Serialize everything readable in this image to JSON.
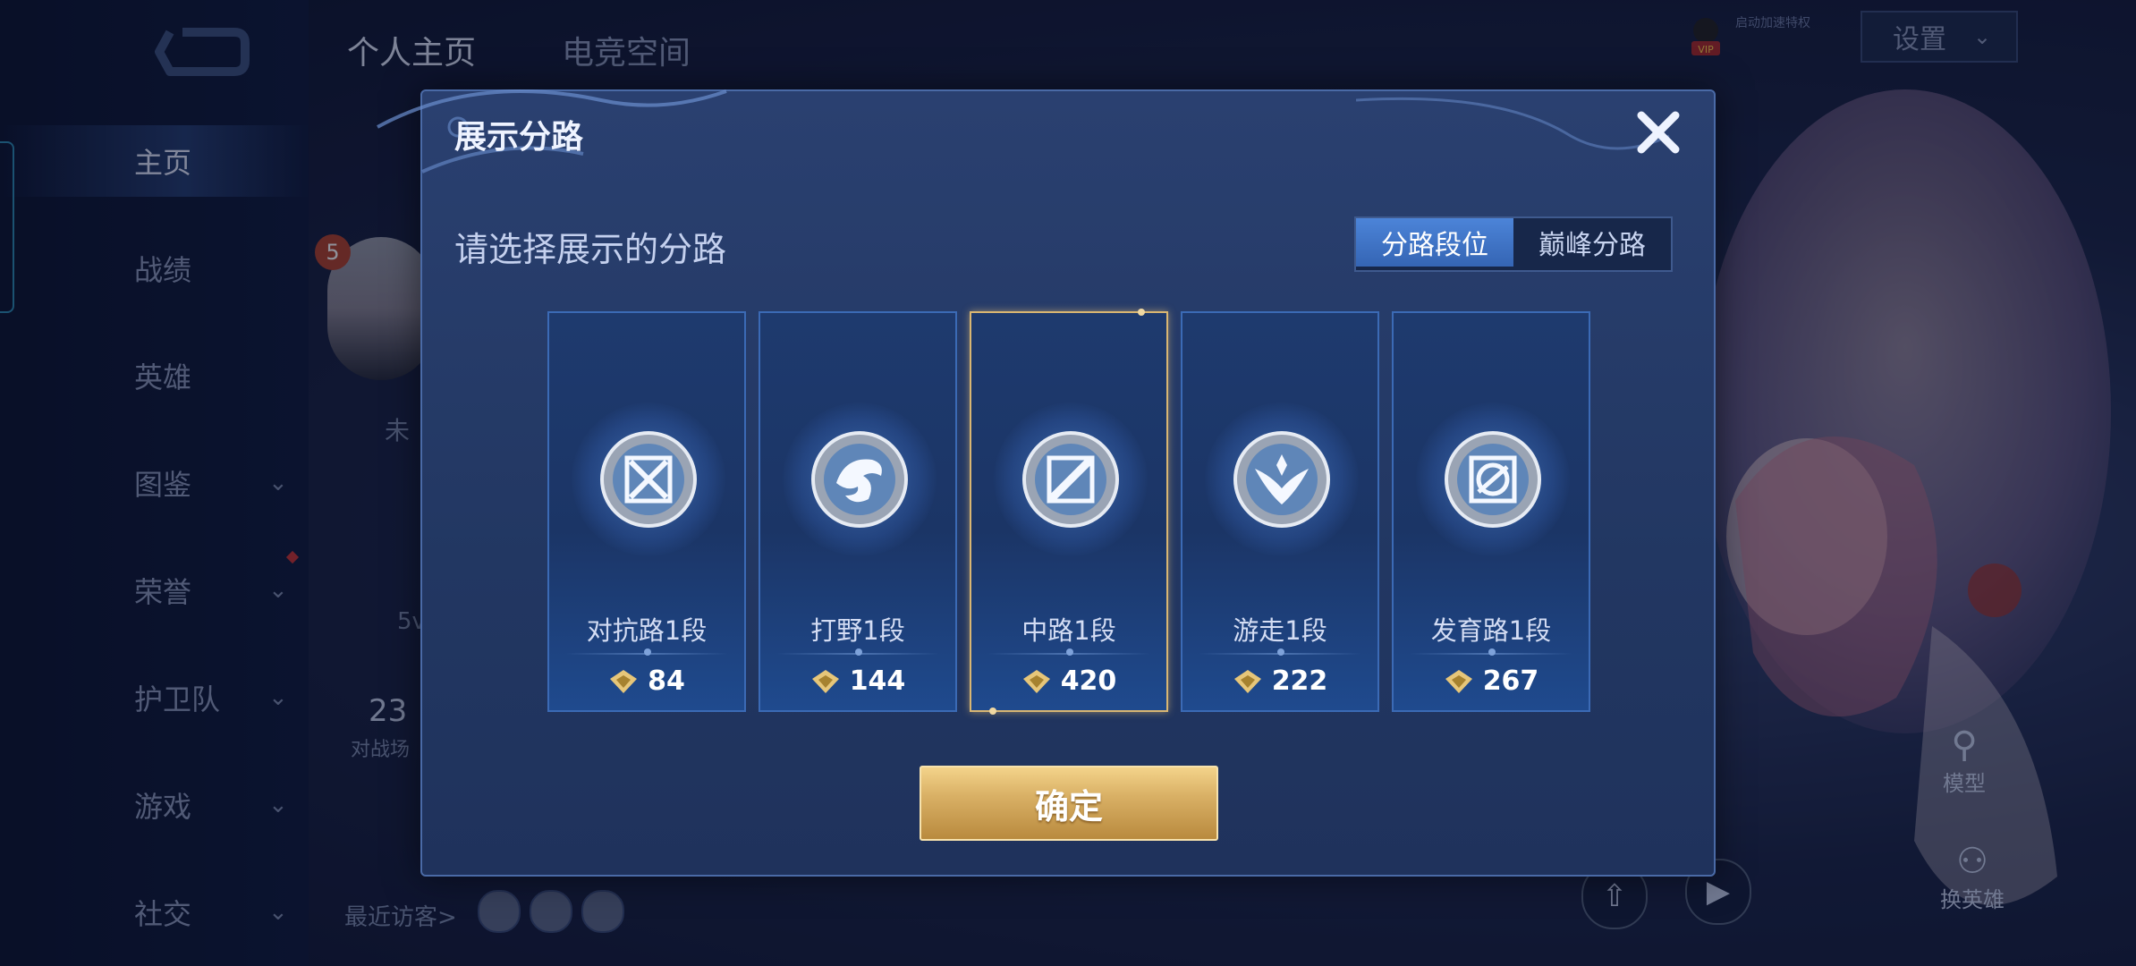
{
  "sidebar": {
    "items": [
      {
        "label": "主页",
        "has_chevron": false
      },
      {
        "label": "战绩",
        "has_chevron": false
      },
      {
        "label": "英雄",
        "has_chevron": false
      },
      {
        "label": "图鉴",
        "has_chevron": true
      },
      {
        "label": "荣誉",
        "has_chevron": true
      },
      {
        "label": "护卫队",
        "has_chevron": true
      },
      {
        "label": "游戏",
        "has_chevron": true
      },
      {
        "label": "社交",
        "has_chevron": true
      }
    ]
  },
  "top_tabs": [
    {
      "label": "个人主页",
      "active": true
    },
    {
      "label": "电竞空间",
      "active": false
    }
  ],
  "header": {
    "vip_text": "启动加速特权",
    "settings_label": "设置"
  },
  "background_profile": {
    "level": "5",
    "status_text": "未",
    "stat_value": "23",
    "stat_label": "对战场",
    "mode_text": "5v",
    "visitors_label": "最近访客>",
    "model_label": "模型",
    "hero_label": "换英雄"
  },
  "dialog": {
    "title": "展示分路",
    "subtitle": "请选择展示的分路",
    "segments": [
      {
        "label": "分路段位",
        "active": true
      },
      {
        "label": "巅峰分路",
        "active": false
      }
    ],
    "lanes": [
      {
        "name": "对抗路1段",
        "score": "84",
        "icon": "clash-lane-icon",
        "selected": false
      },
      {
        "name": "打野1段",
        "score": "144",
        "icon": "jungle-icon",
        "selected": false
      },
      {
        "name": "中路1段",
        "score": "420",
        "icon": "mid-lane-icon",
        "selected": true
      },
      {
        "name": "游走1段",
        "score": "222",
        "icon": "roam-icon",
        "selected": false
      },
      {
        "name": "发育路1段",
        "score": "267",
        "icon": "farm-lane-icon",
        "selected": false
      }
    ],
    "confirm_label": "确定"
  },
  "colors": {
    "accent_gold": "#d9b672",
    "segment_active": "#3f74c8",
    "dialog_bg": "#243a66"
  }
}
